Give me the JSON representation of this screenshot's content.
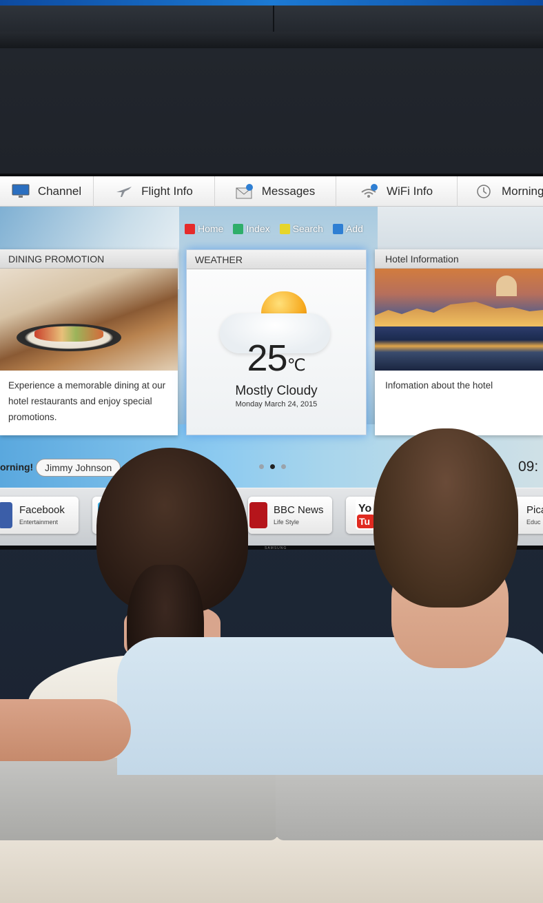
{
  "menu": [
    {
      "label": "Channel",
      "icon": "monitor-icon"
    },
    {
      "label": "Flight Info",
      "icon": "airplane-icon"
    },
    {
      "label": "Messages",
      "icon": "envelope-icon"
    },
    {
      "label": "WiFi Info",
      "icon": "wifi-icon"
    },
    {
      "label": "Morning",
      "icon": "clock-icon"
    }
  ],
  "color_keys": [
    {
      "label": "Home",
      "color": "#e52b2b"
    },
    {
      "label": "Index",
      "color": "#2fae6a"
    },
    {
      "label": "Search",
      "color": "#e6d52a"
    },
    {
      "label": "Add",
      "color": "#2f7fd3"
    }
  ],
  "cards": {
    "dining": {
      "title": "DINING PROMOTION",
      "text": "Experience a memorable dining at our hotel restaurants and enjoy special promotions."
    },
    "weather": {
      "title": "WEATHER",
      "temperature": "25",
      "unit": "℃",
      "condition": "Mostly Cloudy",
      "date": "Monday March 24, 2015"
    },
    "hotel": {
      "title": "Hotel Information",
      "text": "Infomation about the hotel"
    }
  },
  "status": {
    "greeting": "orning!",
    "guest_name": "Jimmy Johnson",
    "clock": "09:",
    "page_index": 2,
    "page_count": 3
  },
  "apps": [
    {
      "name": "Facebook",
      "category": "Entertainment",
      "icon": "facebook-icon"
    },
    {
      "name": "",
      "category": "",
      "icon": "twitter-icon"
    },
    {
      "name": "BBC News",
      "category": "Life Style",
      "icon": "bbc-news-icon"
    },
    {
      "name": "",
      "category": "",
      "icon": "youtube-icon",
      "logo_text": "You Tu"
    },
    {
      "name": "Pica",
      "category": "Educ",
      "icon": "picasa-icon"
    }
  ],
  "brand": "SAMSUNG",
  "colors": {
    "accent_blue": "#1c7ad4",
    "menu_bg": "#ffffff",
    "card_header": "#e3e3e3",
    "weather_glow": "#5096e6"
  }
}
